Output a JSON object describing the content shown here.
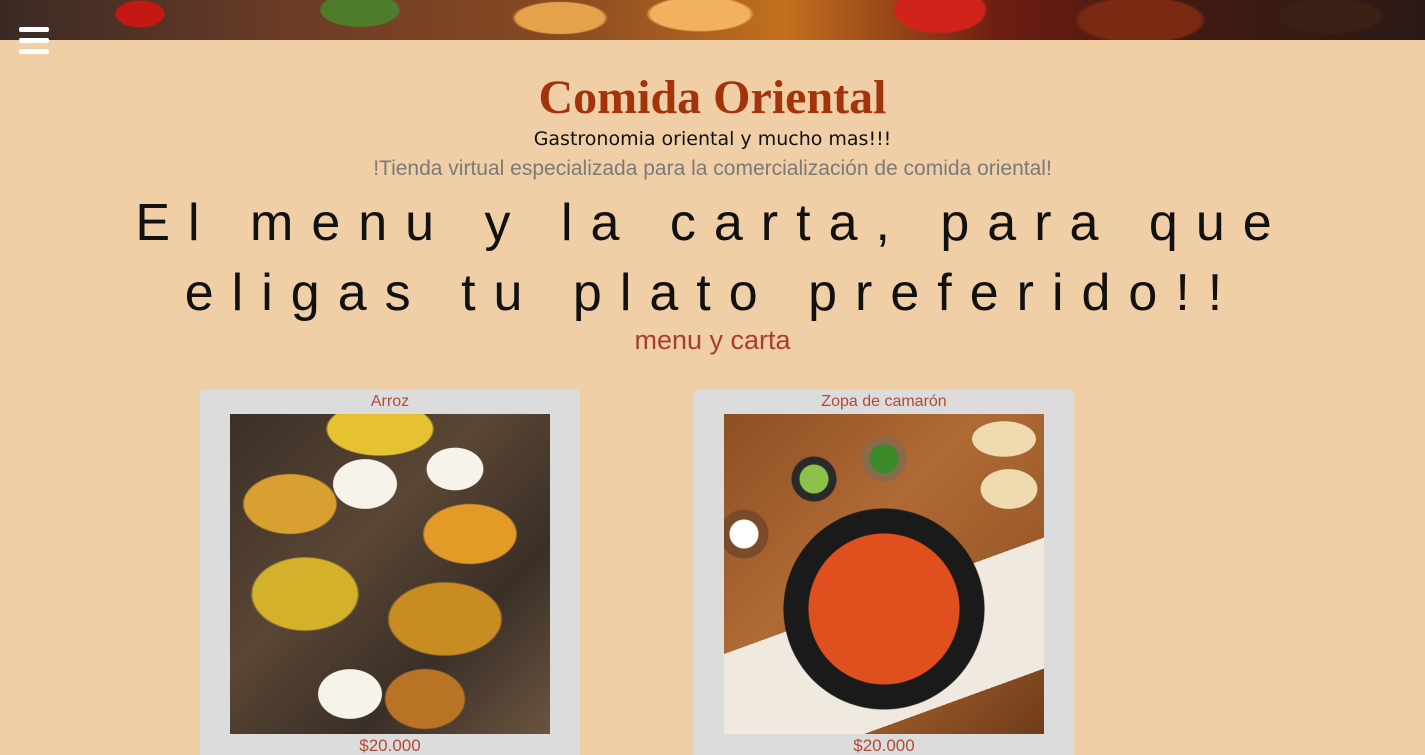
{
  "nav": {
    "menu_icon": "hamburger-menu-icon"
  },
  "header": {
    "title": "Comida Oriental",
    "subtitle": "Gastronomia oriental y mucho mas!!!",
    "tagline": "!Tienda virtual especializada para la comercialización de comida oriental!"
  },
  "hero": {
    "headline": "El menu y la carta, para que eligas tu plato preferido!!",
    "section_label": "menu y carta"
  },
  "products": [
    {
      "name": "Arroz",
      "price": "$20.000"
    },
    {
      "name": "Zopa de camarón",
      "price": "$20.000"
    }
  ],
  "colors": {
    "background": "#f0cea6",
    "title": "#a3330b",
    "accent": "#b14a36",
    "card": "#dcdcdc"
  }
}
